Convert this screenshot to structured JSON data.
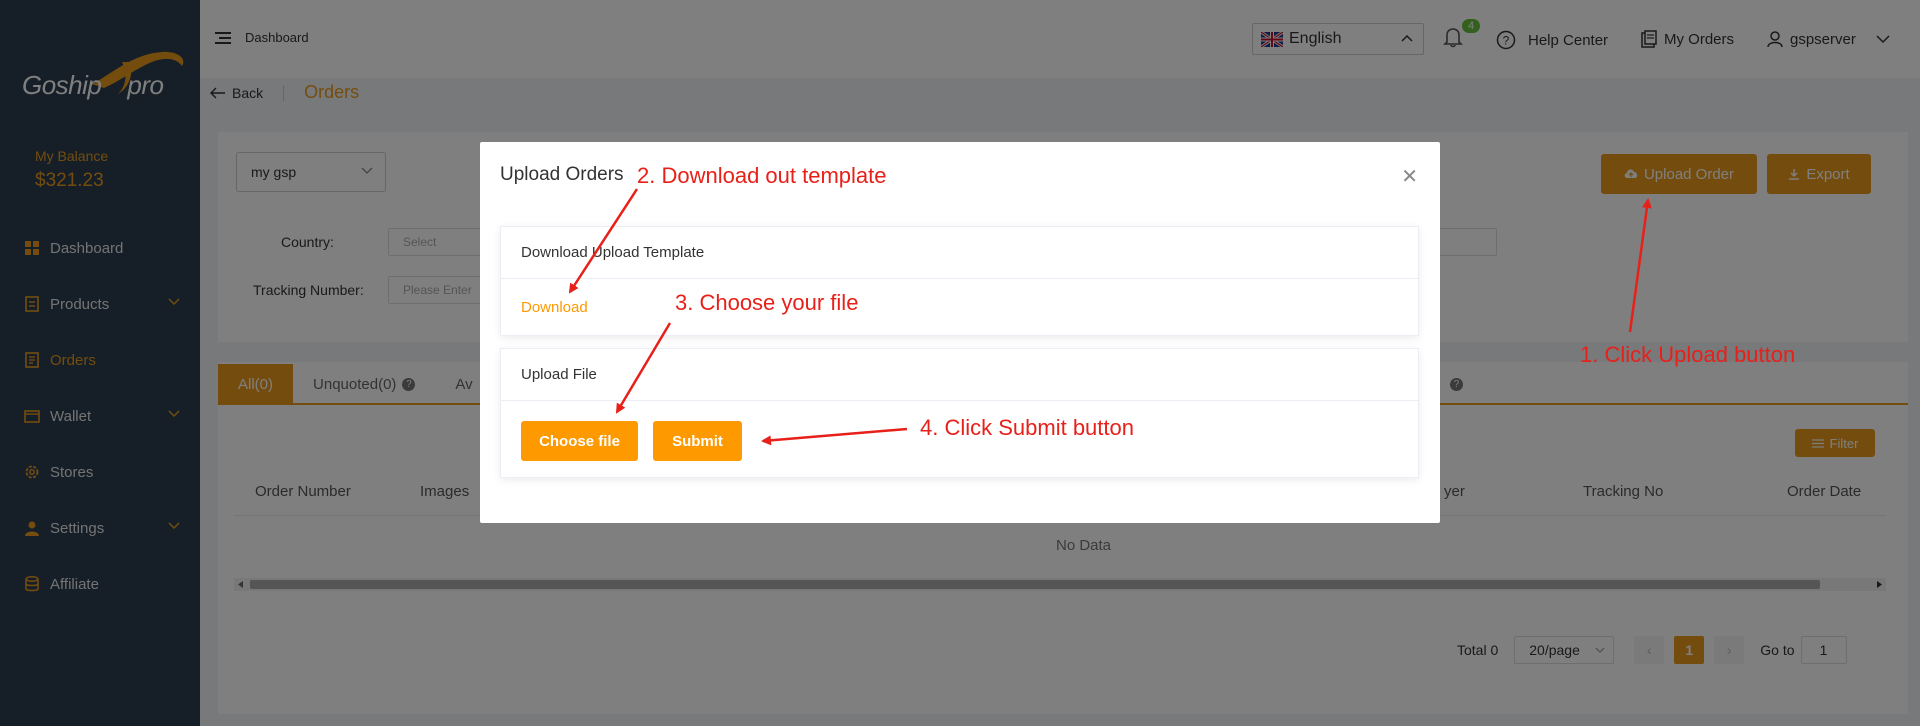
{
  "sidebar": {
    "logo_text": "Goship",
    "logo_suffix": "pro",
    "balance_label": "My Balance",
    "balance_value": "$321.23",
    "items": [
      {
        "label": "Dashboard",
        "icon": "grid-icon",
        "has_chevron": false
      },
      {
        "label": "Products",
        "icon": "document-icon",
        "has_chevron": true
      },
      {
        "label": "Orders",
        "icon": "orders-icon",
        "has_chevron": false
      },
      {
        "label": "Wallet",
        "icon": "wallet-icon",
        "has_chevron": true
      },
      {
        "label": "Stores",
        "icon": "gear-icon",
        "has_chevron": false
      },
      {
        "label": "Settings",
        "icon": "user-icon",
        "has_chevron": true
      },
      {
        "label": "Affiliate",
        "icon": "database-icon",
        "has_chevron": false
      }
    ],
    "active_index": 2
  },
  "header": {
    "breadcrumb": "Dashboard",
    "back_label": "Back",
    "page_title": "Orders",
    "language": "English",
    "notification_count": "4",
    "help_label": "Help Center",
    "my_orders_label": "My Orders",
    "username": "gspserver"
  },
  "filters": {
    "store_value": "my gsp",
    "upload_button": "Upload Order",
    "export_button": "Export",
    "country_label": "Country:",
    "country_placeholder": "Select",
    "tracking_label": "Tracking Number:",
    "tracking_placeholder": "Please Enter"
  },
  "tabs": [
    {
      "label": "All(0)"
    },
    {
      "label": "Unquoted(0)"
    },
    {
      "label": "Av"
    }
  ],
  "table": {
    "filter_button": "Filter",
    "columns": [
      "Order Number",
      "Images",
      "yer",
      "Tracking No",
      "Order Date"
    ],
    "empty_text": "No Data"
  },
  "pagination": {
    "total": "Total 0",
    "page_size": "20/page",
    "current_page": "1",
    "goto_label": "Go to",
    "goto_value": "1"
  },
  "modal": {
    "title": "Upload Orders",
    "template_header": "Download Upload Template",
    "download_link": "Download",
    "upload_header": "Upload File",
    "choose_button": "Choose file",
    "submit_button": "Submit"
  },
  "annotations": {
    "step1": "1. Click Upload button",
    "step2": "2. Download out template",
    "step3": "3. Choose your file",
    "step4": "4. Click Submit button"
  },
  "colors": {
    "accent": "#e89a1d",
    "sidebar_bg": "#2c3e50",
    "annotation": "#e8201a",
    "modal_button": "#ff9900"
  }
}
